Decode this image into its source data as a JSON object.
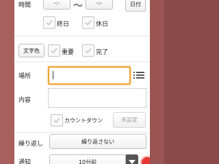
{
  "time": {
    "label": "時間",
    "start_value": "-:-",
    "tilde": "〜",
    "end_value": "-:-",
    "date_button": "日付"
  },
  "checks_row1": [
    {
      "label": "終日",
      "checked": false
    },
    {
      "label": "休日",
      "checked": false
    }
  ],
  "style_row": {
    "text_color_button": "文字色",
    "important": {
      "label": "重要",
      "checked": false
    },
    "done": {
      "label": "完了",
      "checked": false
    }
  },
  "place": {
    "label": "場所",
    "value": "",
    "list_icon": "list-icon"
  },
  "content": {
    "label": "内容",
    "value": ""
  },
  "countdown": {
    "label": "カウントダウン",
    "checked": false,
    "unset_button": "未設定"
  },
  "repeat": {
    "label": "繰り返し",
    "value": "繰り返さない"
  },
  "notify": {
    "label": "通知",
    "value": "10分前"
  },
  "colors": {
    "accent_focus": "#f0a030",
    "remove": "#e53935",
    "check": "#c8c8c8"
  }
}
